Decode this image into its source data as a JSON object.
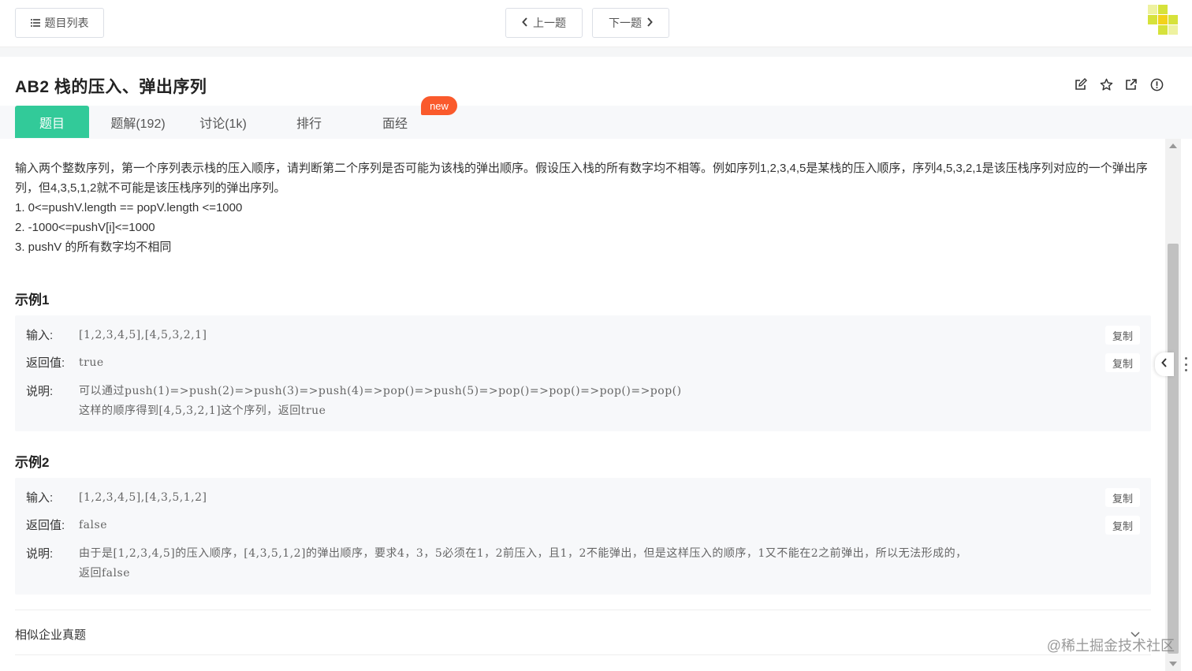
{
  "topbar": {
    "list_label": "题目列表",
    "prev_label": "上一题",
    "next_label": "下一题"
  },
  "problem": {
    "title": "AB2  栈的压入、弹出序列"
  },
  "tabs": [
    {
      "label": "题目",
      "active": true
    },
    {
      "label": "题解(192)",
      "active": false
    },
    {
      "label": "讨论(1k)",
      "active": false
    },
    {
      "label": "排行",
      "active": false
    },
    {
      "label": "面经",
      "active": false
    }
  ],
  "new_badge": "new",
  "description": {
    "line1": "输入两个整数序列，第一个序列表示栈的压入顺序，请判断第二个序列是否可能为该栈的弹出顺序。假设压入栈的所有数字均不相等。例如序列1,2,3,4,5是某栈的压入顺序，序列4,5,3,2,1是该压栈序列对应的一个弹出序列，但4,3,5,1,2就不可能是该压栈序列的弹出序列。",
    "constraints": [
      "1. 0<=pushV.length == popV.length <=1000",
      "2. -1000<=pushV[i]<=1000",
      "3. pushV 的所有数字均不相同"
    ]
  },
  "examples": [
    {
      "title": "示例1",
      "input_label": "输入:",
      "input": "[1,2,3,4,5],[4,5,3,2,1]",
      "output_label": "返回值:",
      "output": "true",
      "explain_label": "说明:",
      "explain_lines": [
        "可以通过push(1)=>push(2)=>push(3)=>push(4)=>pop()=>push(5)=>pop()=>pop()=>pop()=>pop()",
        "这样的顺序得到[4,5,3,2,1]这个序列，返回true"
      ]
    },
    {
      "title": "示例2",
      "input_label": "输入:",
      "input": "[1,2,3,4,5],[4,3,5,1,2]",
      "output_label": "返回值:",
      "output": "false",
      "explain_label": "说明:",
      "explain_lines": [
        "由于是[1,2,3,4,5]的压入顺序，[4,3,5,1,2]的弹出顺序，要求4，3，5必须在1，2前压入，且1，2不能弹出，但是这样压入的顺序，1又不能在2之前弹出，所以无法形成的，",
        "返回false"
      ]
    }
  ],
  "copy_label": "复制",
  "related": {
    "title": "相似企业真题"
  },
  "watermark": "@稀土掘金技术社区",
  "colors": {
    "accent": "#32ca99",
    "badge": "#fa5a2c"
  }
}
